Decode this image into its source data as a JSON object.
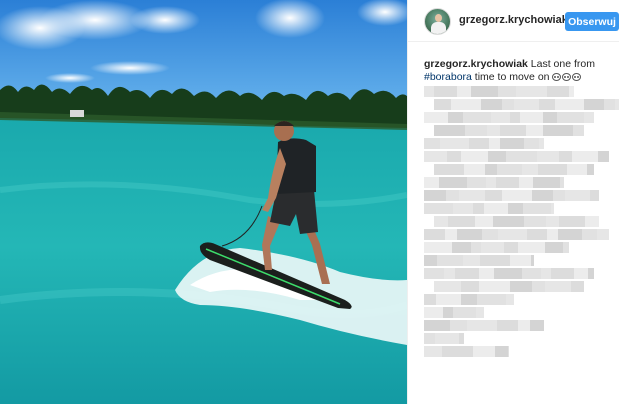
{
  "post": {
    "photo": {
      "icon": "jet-surfboard-photo",
      "colors": {
        "sky": "#3c8fe0",
        "sea": "#1fb3b4",
        "palms": "#143a18"
      }
    },
    "header": {
      "username": "grzegorz.krychowiak",
      "follow_label": "Obserwuj",
      "avatar_icon": "profile-avatar-icon"
    },
    "caption": {
      "username": "grzegorz.krychowiak",
      "text_before": "Last one from",
      "hashtag": "#borabora",
      "text_after": "time to move on",
      "emoji_icons": [
        "face-emoji-icon",
        "face-emoji-icon",
        "face-emoji-icon"
      ]
    },
    "comments_state": "pixelated",
    "colors": {
      "accent": "#3897f0",
      "hashtag": "#003569",
      "text": "#262626"
    }
  }
}
